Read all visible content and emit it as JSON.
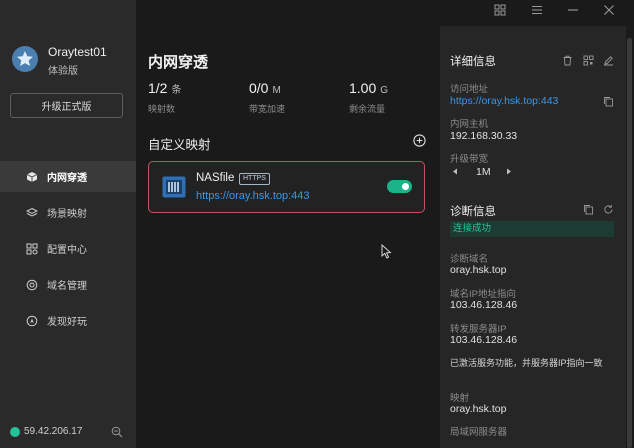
{
  "window": {
    "icons": [
      "grid-icon",
      "menu-icon",
      "minimize-icon",
      "close-icon"
    ]
  },
  "user": {
    "name": "Oraytest01",
    "edition": "体验版",
    "upgrade_label": "升级正式版"
  },
  "sidebar": {
    "items": [
      {
        "label": "内网穿透",
        "icon": "cube-icon",
        "active": true
      },
      {
        "label": "场景映射",
        "icon": "layers-icon",
        "active": false
      },
      {
        "label": "配置中心",
        "icon": "apps-icon",
        "active": false
      },
      {
        "label": "域名管理",
        "icon": "domain-icon",
        "active": false
      },
      {
        "label": "发现好玩",
        "icon": "compass-icon",
        "active": false
      }
    ],
    "ip": "59.42.206.17",
    "status_color": "#22c497"
  },
  "main": {
    "title": "内网穿透",
    "stats": [
      {
        "value": "1/2",
        "unit": "条",
        "label": "映射数"
      },
      {
        "value": "0/0",
        "unit": "M",
        "label": "带宽加速"
      },
      {
        "value": "1.00",
        "unit": "G",
        "label": "剩余流量"
      }
    ],
    "section_title": "自定义映射",
    "mappings": [
      {
        "name": "NASfile",
        "protocol": "HTTPS",
        "url": "https://oray.hsk.top:443",
        "enabled": true
      }
    ]
  },
  "details": {
    "title": "详细信息",
    "access_label": "访问地址",
    "access_url": "https://oray.hsk.top:443",
    "host_label": "内网主机",
    "host_value": "192.168.30.33",
    "bandwidth_label": "升级带宽",
    "bandwidth_value": "1M"
  },
  "diagnosis": {
    "title": "诊断信息",
    "status": "连接成功",
    "domain_label": "诊断域名",
    "domain_value": "oray.hsk.top",
    "ip_label": "域名IP地址指向",
    "ip_value": "103.46.128.46",
    "forward_label": "转发服务器IP",
    "forward_value": "103.46.128.46",
    "note": "已激活服务功能，并服务器IP指向一致",
    "map_label": "映射",
    "map_value": "oray.hsk.top",
    "lan_label": "局域网服务器"
  },
  "colors": {
    "accent_link": "#3d97e6",
    "success": "#24c49a",
    "card_border": "#c64f63"
  }
}
